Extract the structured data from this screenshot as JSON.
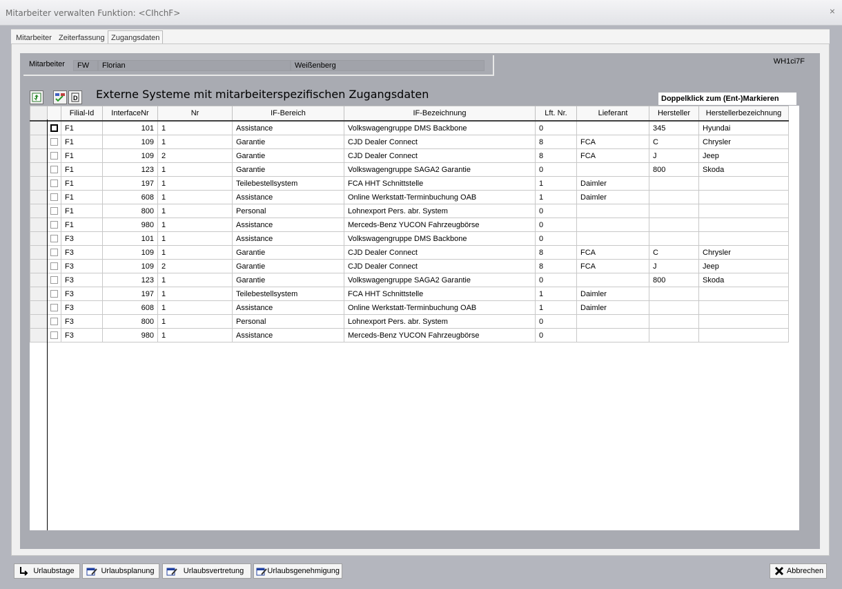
{
  "window": {
    "title": "Mitarbeiter verwalten Funktion: <CIhchF>",
    "close_label": "×"
  },
  "tabs": [
    {
      "label": "Mitarbeiter"
    },
    {
      "label": "Zeiterfassung"
    },
    {
      "label": "Zugangsdaten"
    }
  ],
  "employee": {
    "label": "Mitarbeiter",
    "short": "FW",
    "first_name": "Florian",
    "last_name": "Weißenberg",
    "code": "WH1ci7F"
  },
  "heading": "Externe Systeme mit mitarbeiterspezifischen Zugangsdaten",
  "hint": "Doppelklick zum (Ent-)Markieren",
  "grid": {
    "columns": [
      "Filial-Id",
      "InterfaceNr",
      "Nr",
      "IF-Bereich",
      "IF-Bezeichnung",
      "Lft. Nr.",
      "Lieferant",
      "Hersteller",
      "Herstellerbezeichnung"
    ],
    "rows": [
      [
        "F1",
        "101",
        "1",
        "Assistance",
        "Volkswagengruppe DMS Backbone",
        "0",
        "",
        "345",
        "Hyundai"
      ],
      [
        "F1",
        "109",
        "1",
        "Garantie",
        "CJD Dealer Connect",
        "8",
        "FCA",
        "C",
        "Chrysler"
      ],
      [
        "F1",
        "109",
        "2",
        "Garantie",
        "CJD Dealer Connect",
        "8",
        "FCA",
        "J",
        "Jeep"
      ],
      [
        "F1",
        "123",
        "1",
        "Garantie",
        "Volkswagengruppe SAGA2 Garantie",
        "0",
        "",
        "800",
        "Skoda"
      ],
      [
        "F1",
        "197",
        "1",
        "Teilebestellsystem",
        "FCA HHT Schnittstelle",
        "1",
        "Daimler",
        "",
        ""
      ],
      [
        "F1",
        "608",
        "1",
        "Assistance",
        "Online Werkstatt-Terminbuchung OAB",
        "1",
        "Daimler",
        "",
        ""
      ],
      [
        "F1",
        "800",
        "1",
        "Personal",
        "Lohnexport Pers. abr. System",
        "0",
        "",
        "",
        ""
      ],
      [
        "F1",
        "980",
        "1",
        "Assistance",
        "Merceds-Benz YUCON Fahrzeugbörse",
        "0",
        "",
        "",
        ""
      ],
      [
        "F3",
        "101",
        "1",
        "Assistance",
        "Volkswagengruppe DMS Backbone",
        "0",
        "",
        "",
        ""
      ],
      [
        "F3",
        "109",
        "1",
        "Garantie",
        "CJD Dealer Connect",
        "8",
        "FCA",
        "C",
        "Chrysler"
      ],
      [
        "F3",
        "109",
        "2",
        "Garantie",
        "CJD Dealer Connect",
        "8",
        "FCA",
        "J",
        "Jeep"
      ],
      [
        "F3",
        "123",
        "1",
        "Garantie",
        "Volkswagengruppe SAGA2 Garantie",
        "0",
        "",
        "800",
        "Skoda"
      ],
      [
        "F3",
        "197",
        "1",
        "Teilebestellsystem",
        "FCA HHT Schnittstelle",
        "1",
        "Daimler",
        "",
        ""
      ],
      [
        "F3",
        "608",
        "1",
        "Assistance",
        "Online Werkstatt-Terminbuchung OAB",
        "1",
        "Daimler",
        "",
        ""
      ],
      [
        "F3",
        "800",
        "1",
        "Personal",
        "Lohnexport Pers. abr. System",
        "0",
        "",
        "",
        ""
      ],
      [
        "F3",
        "980",
        "1",
        "Assistance",
        "Merceds-Benz YUCON Fahrzeugbörse",
        "0",
        "",
        "",
        ""
      ]
    ]
  },
  "footer": {
    "urlaubstage": "Urlaubstage",
    "urlaubsplanung": "Urlaubsplanung",
    "urlaubsvertretung": "Urlaubsvertretung",
    "urlaubsgenehmigung": "Urlaubsgenehmigung",
    "abbrechen": "Abbrechen"
  }
}
